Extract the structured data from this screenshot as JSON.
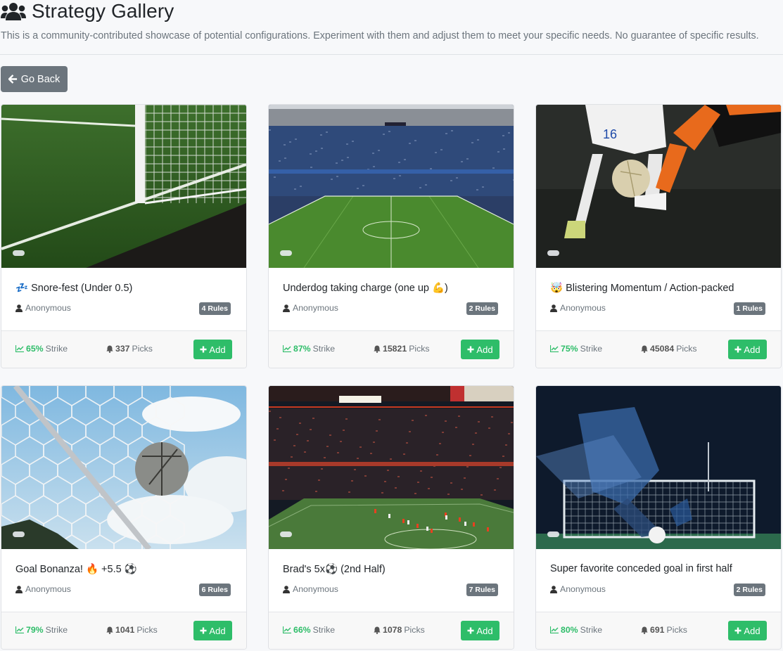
{
  "header": {
    "title": "Strategy Gallery",
    "subtitle": "This is a community-contributed showcase of potential configurations. Experiment with them and adjust them to meet your specific needs. No guarantee of specific results.",
    "icon": "users-icon"
  },
  "back_button": {
    "label": "Go Back",
    "icon": "arrow-left-icon"
  },
  "colors": {
    "accent": "#2ebd69",
    "secondary": "#6c757d"
  },
  "cards": [
    {
      "emoji": "💤",
      "title": "Snore-fest (Under 0.5)",
      "author": "Anonymous",
      "rules": "4 Rules",
      "strike_pct": "65%",
      "strike_label": "Strike",
      "picks_count": "337",
      "picks_label": "Picks",
      "add_label": "Add",
      "image": "goal-net-grass"
    },
    {
      "emoji": "",
      "title": "Underdog taking charge (one up 💪)",
      "author": "Anonymous",
      "rules": "2 Rules",
      "strike_pct": "87%",
      "strike_label": "Strike",
      "picks_count": "15821",
      "picks_label": "Picks",
      "add_label": "Add",
      "image": "stadium-daytime"
    },
    {
      "emoji": "🤯",
      "title": "Blistering Momentum / Action-packed",
      "author": "Anonymous",
      "rules": "1 Rules",
      "strike_pct": "75%",
      "strike_label": "Strike",
      "picks_count": "45084",
      "picks_label": "Picks",
      "add_label": "Add",
      "image": "players-tackle"
    },
    {
      "emoji": "",
      "title": "Goal Bonanza! 🔥 +5.5 ⚽",
      "author": "Anonymous",
      "rules": "6 Rules",
      "strike_pct": "79%",
      "strike_label": "Strike",
      "picks_count": "1041",
      "picks_label": "Picks",
      "add_label": "Add",
      "image": "ball-in-net-sky"
    },
    {
      "emoji": "",
      "title": "Brad's 5x⚽ (2nd Half)",
      "author": "Anonymous",
      "rules": "7 Rules",
      "strike_pct": "66%",
      "strike_label": "Strike",
      "picks_count": "1078",
      "picks_label": "Picks",
      "add_label": "Add",
      "image": "stadium-night"
    },
    {
      "emoji": "",
      "title": "Super favorite conceded goal in first half",
      "author": "Anonymous",
      "rules": "2 Rules",
      "strike_pct": "80%",
      "strike_label": "Strike",
      "picks_count": "691",
      "picks_label": "Picks",
      "add_label": "Add",
      "image": "striker-motion-blur"
    }
  ]
}
